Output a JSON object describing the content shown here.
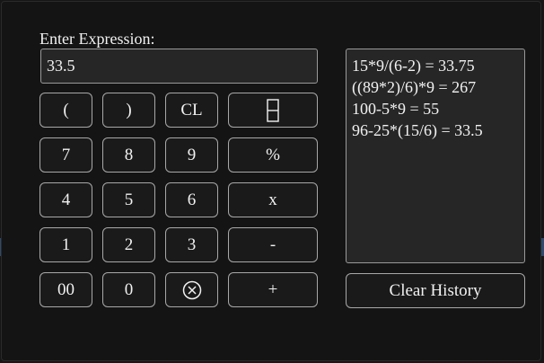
{
  "app": {
    "input_label": "Enter Expression:",
    "expression_value": "33.5"
  },
  "keypad": {
    "rows": [
      [
        "(",
        ")",
        "CL",
        "backspace-icon"
      ],
      [
        "7",
        "8",
        "9",
        "%"
      ],
      [
        "4",
        "5",
        "6",
        "x"
      ],
      [
        "1",
        "2",
        "3",
        "-"
      ],
      [
        "00",
        "0",
        "clear-entry-icon",
        "+"
      ]
    ]
  },
  "history": {
    "entries": [
      "15*9/(6-2) = 33.75",
      "((89*2)/6)*9 = 267",
      "100-5*9 = 55",
      "96-25*(15/6) = 33.5"
    ],
    "clear_label": "Clear History"
  }
}
